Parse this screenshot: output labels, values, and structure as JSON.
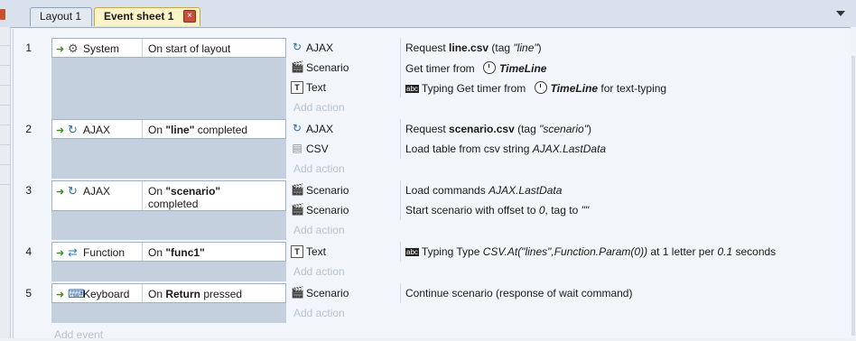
{
  "tabs": [
    {
      "label": "Layout 1",
      "active": false
    },
    {
      "label": "Event sheet 1",
      "active": true
    }
  ],
  "add_action_label": "Add action",
  "add_event_label": "Add event",
  "events": [
    {
      "number": "1",
      "condition": {
        "object": "System",
        "icon": "gear-icon",
        "text": "On start of layout"
      },
      "actions": [
        {
          "object": "AJAX",
          "icon": "ajax-icon",
          "desc_parts": [
            [
              "Request ",
              ""
            ],
            [
              "line.csv",
              "b"
            ],
            [
              " (tag ",
              ""
            ],
            [
              "\"line\"",
              "it"
            ],
            [
              ")",
              ""
            ]
          ]
        },
        {
          "object": "Scenario",
          "icon": "clapper-icon",
          "desc_parts": [
            [
              "Get timer from ",
              ""
            ],
            [
              "TimeLine",
              "clock"
            ]
          ]
        },
        {
          "object": "Text",
          "icon": "text-icon",
          "desc_parts": [
            [
              "abc",
              "abc"
            ],
            [
              "Typing Get timer from ",
              ""
            ],
            [
              "TimeLine",
              "clock"
            ],
            [
              " for text-typing",
              ""
            ]
          ]
        }
      ]
    },
    {
      "number": "2",
      "condition": {
        "object": "AJAX",
        "icon": "ajax-icon",
        "text_parts": [
          [
            "On ",
            ""
          ],
          [
            "\"line\"",
            "b"
          ],
          [
            " completed",
            ""
          ]
        ]
      },
      "actions": [
        {
          "object": "AJAX",
          "icon": "ajax-icon",
          "desc_parts": [
            [
              "Request ",
              ""
            ],
            [
              "scenario.csv",
              "b"
            ],
            [
              " (tag ",
              ""
            ],
            [
              "\"scenario\"",
              "it"
            ],
            [
              ")",
              ""
            ]
          ]
        },
        {
          "object": "CSV",
          "icon": "csv-icon",
          "desc_parts": [
            [
              "Load table from csv string ",
              ""
            ],
            [
              "AJAX.LastData",
              "it"
            ]
          ]
        }
      ]
    },
    {
      "number": "3",
      "condition": {
        "object": "AJAX",
        "icon": "ajax-icon",
        "text_parts": [
          [
            "On ",
            ""
          ],
          [
            "\"scenario\"",
            "b"
          ],
          [
            " completed",
            ""
          ]
        ]
      },
      "actions": [
        {
          "object": "Scenario",
          "icon": "clapper-icon",
          "desc_parts": [
            [
              "Load commands ",
              ""
            ],
            [
              "AJAX.LastData",
              "it"
            ]
          ]
        },
        {
          "object": "Scenario",
          "icon": "clapper-icon",
          "desc_parts": [
            [
              "Start scenario with offset to ",
              ""
            ],
            [
              "0",
              "it"
            ],
            [
              ", tag to ",
              ""
            ],
            [
              "\"\"",
              "it"
            ]
          ]
        }
      ]
    },
    {
      "number": "4",
      "condition": {
        "object": "Function",
        "icon": "function-icon",
        "text_parts": [
          [
            "On ",
            ""
          ],
          [
            "\"func1\"",
            "b"
          ]
        ]
      },
      "actions": [
        {
          "object": "Text",
          "icon": "text-icon",
          "desc_parts": [
            [
              "abc",
              "abc"
            ],
            [
              "Typing Type ",
              ""
            ],
            [
              "CSV.At(\"lines\",Function.Param(0))",
              "it"
            ],
            [
              "  at 1 letter per ",
              ""
            ],
            [
              "0.1",
              "it"
            ],
            [
              " seconds",
              ""
            ]
          ]
        }
      ]
    },
    {
      "number": "5",
      "condition": {
        "object": "Keyboard",
        "icon": "keyboard-icon",
        "text_parts": [
          [
            "On ",
            ""
          ],
          [
            "Return",
            "b"
          ],
          [
            " pressed",
            ""
          ]
        ]
      },
      "actions": [
        {
          "object": "Scenario",
          "icon": "clapper-icon",
          "desc_parts": [
            [
              "Continue scenario (response of wait command)",
              ""
            ]
          ]
        }
      ]
    }
  ]
}
